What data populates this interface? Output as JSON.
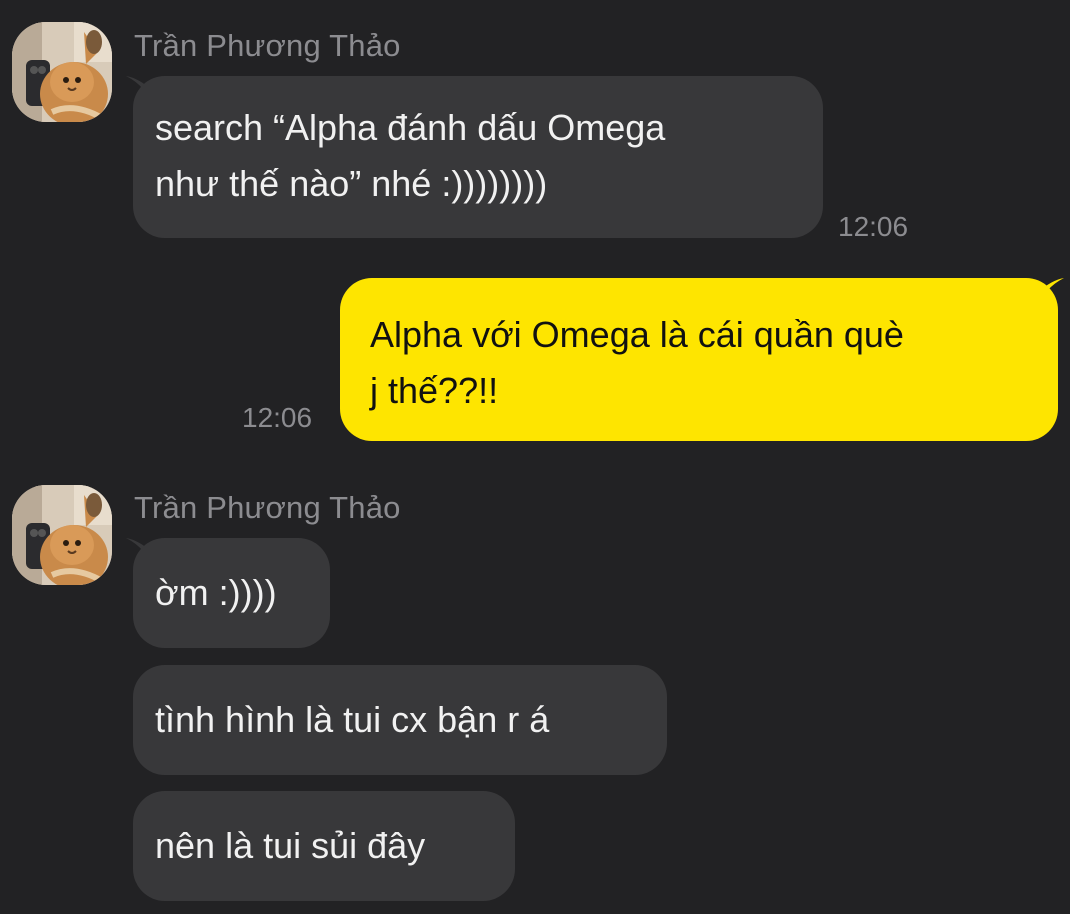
{
  "messages": [
    {
      "sender": "Trần Phương Thảo",
      "direction": "incoming",
      "lines": [
        "search “Alpha đánh dấu Omega",
        "như thế nào” nhé :))))))))"
      ],
      "time": "12:06"
    },
    {
      "direction": "outgoing",
      "lines": [
        "Alpha với Omega là cái quần què",
        "j thế??!!"
      ],
      "time": "12:06"
    },
    {
      "sender": "Trần Phương Thảo",
      "direction": "incoming",
      "lines": [
        "ờm :))))"
      ]
    },
    {
      "direction": "incoming",
      "lines": [
        "tình hình là tui cx bận r á"
      ]
    },
    {
      "direction": "incoming",
      "lines": [
        "nên là tui sủi đây"
      ]
    }
  ],
  "colors": {
    "background": "#222224",
    "incoming_bubble": "#38383a",
    "outgoing_bubble": "#fee500",
    "meta_text": "#8c8c90"
  },
  "icons": [
    "avatar-cat-photo"
  ]
}
